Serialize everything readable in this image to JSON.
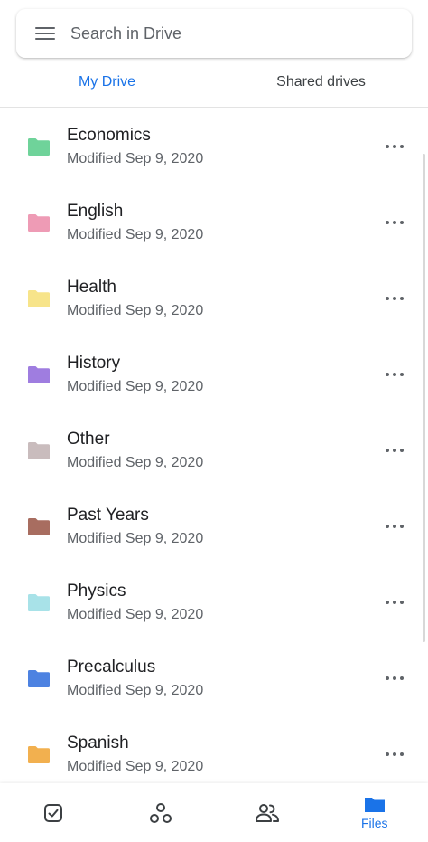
{
  "search": {
    "placeholder": "Search in Drive"
  },
  "tabs": [
    {
      "label": "My Drive",
      "active": true
    },
    {
      "label": "Shared drives",
      "active": false
    }
  ],
  "folders": [
    {
      "name": "Economics",
      "modified": "Modified Sep 9, 2020",
      "color": "#6fd39a"
    },
    {
      "name": "English",
      "modified": "Modified Sep 9, 2020",
      "color": "#ee9bb5"
    },
    {
      "name": "Health",
      "modified": "Modified Sep 9, 2020",
      "color": "#f7e48a"
    },
    {
      "name": "History",
      "modified": "Modified Sep 9, 2020",
      "color": "#9f7de0"
    },
    {
      "name": "Other",
      "modified": "Modified Sep 9, 2020",
      "color": "#c9bcbd"
    },
    {
      "name": "Past Years",
      "modified": "Modified Sep 9, 2020",
      "color": "#a86d60"
    },
    {
      "name": "Physics",
      "modified": "Modified Sep 9, 2020",
      "color": "#a8e2e8"
    },
    {
      "name": "Precalculus",
      "modified": "Modified Sep 9, 2020",
      "color": "#4d82e1"
    },
    {
      "name": "Spanish",
      "modified": "Modified Sep 9, 2020",
      "color": "#f2b04f"
    }
  ],
  "bottom_nav": {
    "items": [
      {
        "name": "priority",
        "icon": "checkbox-icon",
        "label": ""
      },
      {
        "name": "workspaces",
        "icon": "workspaces-icon",
        "label": ""
      },
      {
        "name": "shared",
        "icon": "people-icon",
        "label": ""
      },
      {
        "name": "files",
        "icon": "folder-icon",
        "label": "Files",
        "active": true
      }
    ]
  },
  "colors": {
    "accent": "#1a73e8",
    "icon_gray": "#5f6368"
  }
}
